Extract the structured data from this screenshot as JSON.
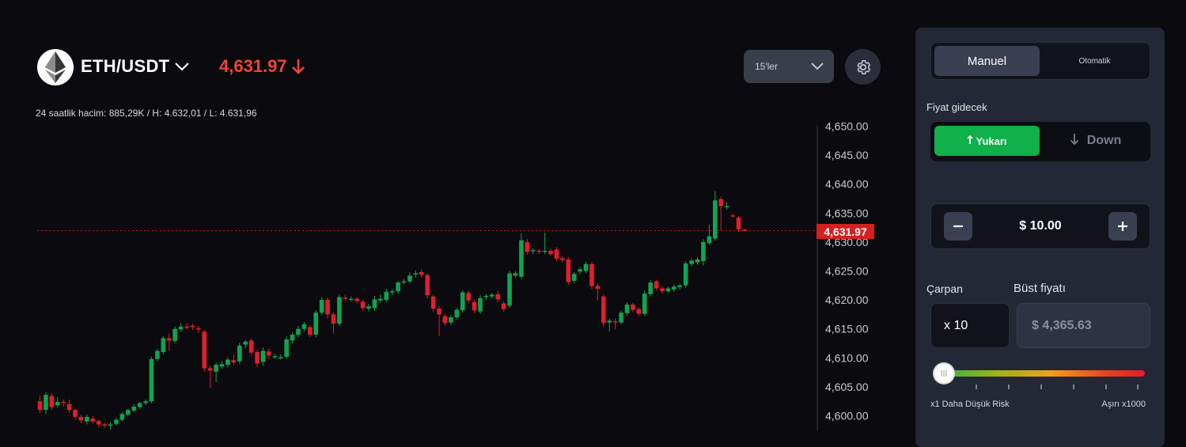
{
  "header": {
    "pair": "ETH/USDT",
    "price": "4,631.97",
    "stats": "24 saatlik hacim: 885,29K / H: 4.632,01 / L: 4.631,96",
    "interval": "15'ler"
  },
  "chart": {
    "y_ticks": [
      "4,650.00",
      "4,645.00",
      "4,640.00",
      "4,635.00",
      "4,630.00",
      "4,625.00",
      "4,620.00",
      "4,615.00",
      "4,610.00",
      "4,605.00",
      "4,600.00"
    ],
    "current_price_tag": "4,631.97",
    "colors": {
      "up": "#10a352",
      "down": "#e01e2e",
      "price_line": "#e01e2e"
    }
  },
  "panel": {
    "tabs": [
      "Manuel",
      "Otomatik"
    ],
    "direction_label": "Fiyat gidecek",
    "up_label": "Yukarı",
    "down_label": "Down",
    "amount": "$ 10.00",
    "multiplier_label": "Çarpan",
    "bust_label": "Büst fiyatı",
    "multiplier_value": "x 10",
    "bust_value": "$ 4,365.63",
    "risk_low_label": "x1 Daha Düşük Risk",
    "risk_high_label": "Aşırı x1000",
    "colors": {
      "up_button": "#10b04a",
      "panel_bg": "#242735"
    }
  },
  "chart_data": {
    "type": "candlestick",
    "y_range": [
      4600,
      4650
    ],
    "candles": [
      {
        "o": 4602.5,
        "c": 4601.0,
        "h": 4603.5,
        "l": 4600.5
      },
      {
        "o": 4601.0,
        "c": 4603.6,
        "h": 4604.1,
        "l": 4600.3
      },
      {
        "o": 4603.4,
        "c": 4601.5,
        "h": 4603.9,
        "l": 4601.0
      },
      {
        "o": 4601.8,
        "c": 4602.4,
        "h": 4603.2,
        "l": 4601.4
      },
      {
        "o": 4602.4,
        "c": 4602.2,
        "h": 4602.8,
        "l": 4601.6
      },
      {
        "o": 4602.0,
        "c": 4601.0,
        "h": 4602.8,
        "l": 4600.5
      },
      {
        "o": 4601.0,
        "c": 4599.8,
        "h": 4601.2,
        "l": 4599.4
      },
      {
        "o": 4599.8,
        "c": 4599.2,
        "h": 4600.2,
        "l": 4598.7
      },
      {
        "o": 4599.0,
        "c": 4599.8,
        "h": 4600.2,
        "l": 4598.5
      },
      {
        "o": 4599.5,
        "c": 4599.0,
        "h": 4600.0,
        "l": 4598.6
      },
      {
        "o": 4599.1,
        "c": 4598.5,
        "h": 4599.3,
        "l": 4598.0
      },
      {
        "o": 4598.5,
        "c": 4598.3,
        "h": 4598.8,
        "l": 4597.9
      },
      {
        "o": 4598.3,
        "c": 4598.5,
        "h": 4598.9,
        "l": 4597.6
      },
      {
        "o": 4598.6,
        "c": 4599.3,
        "h": 4599.7,
        "l": 4598.3
      },
      {
        "o": 4599.3,
        "c": 4600.3,
        "h": 4600.6,
        "l": 4599.0
      },
      {
        "o": 4600.2,
        "c": 4601.0,
        "h": 4601.2,
        "l": 4599.9
      },
      {
        "o": 4600.9,
        "c": 4601.6,
        "h": 4602.0,
        "l": 4600.6
      },
      {
        "o": 4601.5,
        "c": 4602.2,
        "h": 4602.4,
        "l": 4601.2
      },
      {
        "o": 4602.2,
        "c": 4602.5,
        "h": 4602.8,
        "l": 4601.8
      },
      {
        "o": 4602.5,
        "c": 4609.8,
        "h": 4610.2,
        "l": 4602.2
      },
      {
        "o": 4609.8,
        "c": 4611.2,
        "h": 4611.6,
        "l": 4609.4
      },
      {
        "o": 4611.0,
        "c": 4613.4,
        "h": 4613.7,
        "l": 4610.6
      },
      {
        "o": 4613.4,
        "c": 4613.0,
        "h": 4614.2,
        "l": 4611.2
      },
      {
        "o": 4612.9,
        "c": 4615.0,
        "h": 4615.4,
        "l": 4612.5
      },
      {
        "o": 4614.9,
        "c": 4615.4,
        "h": 4616.0,
        "l": 4614.5
      },
      {
        "o": 4615.4,
        "c": 4615.3,
        "h": 4616.0,
        "l": 4614.9
      },
      {
        "o": 4615.5,
        "c": 4615.4,
        "h": 4615.9,
        "l": 4614.8
      },
      {
        "o": 4615.1,
        "c": 4614.9,
        "h": 4615.5,
        "l": 4614.3
      },
      {
        "o": 4614.5,
        "c": 4608.2,
        "h": 4614.9,
        "l": 4607.6
      },
      {
        "o": 4608.2,
        "c": 4607.8,
        "h": 4608.6,
        "l": 4604.8
      },
      {
        "o": 4607.6,
        "c": 4608.8,
        "h": 4609.2,
        "l": 4605.8
      },
      {
        "o": 4608.5,
        "c": 4608.9,
        "h": 4609.4,
        "l": 4608.1
      },
      {
        "o": 4608.8,
        "c": 4609.7,
        "h": 4610.1,
        "l": 4608.3
      },
      {
        "o": 4609.6,
        "c": 4609.2,
        "h": 4610.6,
        "l": 4608.8
      },
      {
        "o": 4609.4,
        "c": 4612.1,
        "h": 4612.6,
        "l": 4608.9
      },
      {
        "o": 4612.3,
        "c": 4612.8,
        "h": 4613.1,
        "l": 4611.6
      },
      {
        "o": 4613.0,
        "c": 4610.9,
        "h": 4613.4,
        "l": 4610.4
      },
      {
        "o": 4611.0,
        "c": 4609.0,
        "h": 4611.4,
        "l": 4608.4
      },
      {
        "o": 4609.3,
        "c": 4611.2,
        "h": 4611.8,
        "l": 4608.6
      },
      {
        "o": 4611.1,
        "c": 4610.4,
        "h": 4611.6,
        "l": 4609.8
      },
      {
        "o": 4610.3,
        "c": 4610.3,
        "h": 4610.7,
        "l": 4609.8
      },
      {
        "o": 4610.1,
        "c": 4610.1,
        "h": 4610.6,
        "l": 4609.7
      },
      {
        "o": 4610.2,
        "c": 4613.2,
        "h": 4613.7,
        "l": 4609.8
      },
      {
        "o": 4613.0,
        "c": 4614.0,
        "h": 4614.4,
        "l": 4612.5
      },
      {
        "o": 4614.0,
        "c": 4615.0,
        "h": 4615.5,
        "l": 4613.6
      },
      {
        "o": 4615.0,
        "c": 4615.8,
        "h": 4616.2,
        "l": 4614.5
      },
      {
        "o": 4615.3,
        "c": 4614.0,
        "h": 4615.6,
        "l": 4613.6
      },
      {
        "o": 4614.0,
        "c": 4617.8,
        "h": 4618.2,
        "l": 4613.6
      },
      {
        "o": 4617.8,
        "c": 4620.0,
        "h": 4620.5,
        "l": 4617.4
      },
      {
        "o": 4620.0,
        "c": 4617.5,
        "h": 4620.4,
        "l": 4616.8
      },
      {
        "o": 4617.5,
        "c": 4615.9,
        "h": 4617.8,
        "l": 4614.2
      },
      {
        "o": 4615.9,
        "c": 4620.5,
        "h": 4620.9,
        "l": 4615.5
      },
      {
        "o": 4620.4,
        "c": 4620.2,
        "h": 4620.9,
        "l": 4619.9
      },
      {
        "o": 4620.0,
        "c": 4620.2,
        "h": 4620.6,
        "l": 4619.7
      },
      {
        "o": 4620.2,
        "c": 4619.8,
        "h": 4620.5,
        "l": 4619.4
      },
      {
        "o": 4619.7,
        "c": 4618.6,
        "h": 4620.0,
        "l": 4618.1
      },
      {
        "o": 4618.5,
        "c": 4618.9,
        "h": 4619.3,
        "l": 4618.0
      },
      {
        "o": 4618.6,
        "c": 4620.1,
        "h": 4620.7,
        "l": 4618.1
      },
      {
        "o": 4619.9,
        "c": 4620.2,
        "h": 4620.9,
        "l": 4619.5
      },
      {
        "o": 4620.0,
        "c": 4621.4,
        "h": 4621.9,
        "l": 4619.6
      },
      {
        "o": 4621.3,
        "c": 4621.5,
        "h": 4621.9,
        "l": 4620.8
      },
      {
        "o": 4621.5,
        "c": 4623.0,
        "h": 4623.3,
        "l": 4621.1
      },
      {
        "o": 4623.0,
        "c": 4623.2,
        "h": 4623.6,
        "l": 4622.7
      },
      {
        "o": 4623.2,
        "c": 4624.2,
        "h": 4624.8,
        "l": 4622.9
      },
      {
        "o": 4624.4,
        "c": 4624.6,
        "h": 4625.1,
        "l": 4623.9
      },
      {
        "o": 4624.8,
        "c": 4624.3,
        "h": 4625.3,
        "l": 4623.8
      },
      {
        "o": 4624.3,
        "c": 4620.8,
        "h": 4624.6,
        "l": 4620.3
      },
      {
        "o": 4620.6,
        "c": 4618.5,
        "h": 4620.9,
        "l": 4617.9
      },
      {
        "o": 4618.5,
        "c": 4617.5,
        "h": 4618.9,
        "l": 4613.8
      },
      {
        "o": 4617.2,
        "c": 4616.0,
        "h": 4617.6,
        "l": 4615.6
      },
      {
        "o": 4616.1,
        "c": 4617.0,
        "h": 4617.4,
        "l": 4615.7
      },
      {
        "o": 4617.0,
        "c": 4618.3,
        "h": 4618.6,
        "l": 4616.6
      },
      {
        "o": 4618.2,
        "c": 4621.3,
        "h": 4621.7,
        "l": 4617.8
      },
      {
        "o": 4621.2,
        "c": 4619.9,
        "h": 4621.6,
        "l": 4619.4
      },
      {
        "o": 4619.6,
        "c": 4618.2,
        "h": 4620.0,
        "l": 4617.7
      },
      {
        "o": 4618.0,
        "c": 4620.3,
        "h": 4620.8,
        "l": 4617.6
      },
      {
        "o": 4620.5,
        "c": 4620.7,
        "h": 4621.0,
        "l": 4620.0
      },
      {
        "o": 4620.6,
        "c": 4620.9,
        "h": 4621.2,
        "l": 4620.2
      },
      {
        "o": 4621.0,
        "c": 4620.1,
        "h": 4621.5,
        "l": 4619.6
      },
      {
        "o": 4619.4,
        "c": 4618.4,
        "h": 4619.8,
        "l": 4617.9
      },
      {
        "o": 4619.0,
        "c": 4624.6,
        "h": 4625.0,
        "l": 4618.6
      },
      {
        "o": 4624.2,
        "c": 4624.6,
        "h": 4625.0,
        "l": 4623.9
      },
      {
        "o": 4624.0,
        "c": 4630.3,
        "h": 4631.5,
        "l": 4623.6
      },
      {
        "o": 4630.0,
        "c": 4628.3,
        "h": 4630.5,
        "l": 4627.8
      },
      {
        "o": 4628.4,
        "c": 4628.6,
        "h": 4628.9,
        "l": 4627.9
      },
      {
        "o": 4628.5,
        "c": 4628.3,
        "h": 4628.8,
        "l": 4627.9
      },
      {
        "o": 4628.3,
        "c": 4628.5,
        "h": 4631.6,
        "l": 4627.9
      },
      {
        "o": 4628.5,
        "c": 4627.9,
        "h": 4628.8,
        "l": 4627.6
      },
      {
        "o": 4628.7,
        "c": 4627.1,
        "h": 4629.1,
        "l": 4626.7
      },
      {
        "o": 4627.2,
        "c": 4626.9,
        "h": 4627.5,
        "l": 4626.5
      },
      {
        "o": 4627.0,
        "c": 4623.1,
        "h": 4627.4,
        "l": 4622.6
      },
      {
        "o": 4623.3,
        "c": 4624.5,
        "h": 4624.8,
        "l": 4622.8
      },
      {
        "o": 4624.9,
        "c": 4625.3,
        "h": 4625.7,
        "l": 4624.4
      },
      {
        "o": 4625.0,
        "c": 4626.2,
        "h": 4626.6,
        "l": 4624.6
      },
      {
        "o": 4626.2,
        "c": 4622.4,
        "h": 4626.6,
        "l": 4621.9
      },
      {
        "o": 4622.4,
        "c": 4621.9,
        "h": 4622.8,
        "l": 4619.9
      },
      {
        "o": 4620.6,
        "c": 4616.0,
        "h": 4621.0,
        "l": 4615.3
      },
      {
        "o": 4616.1,
        "c": 4616.4,
        "h": 4616.8,
        "l": 4614.5
      },
      {
        "o": 4616.3,
        "c": 4616.1,
        "h": 4616.8,
        "l": 4614.9
      },
      {
        "o": 4616.1,
        "c": 4617.8,
        "h": 4618.2,
        "l": 4615.8
      },
      {
        "o": 4617.7,
        "c": 4619.2,
        "h": 4619.6,
        "l": 4617.3
      },
      {
        "o": 4619.2,
        "c": 4618.3,
        "h": 4619.5,
        "l": 4617.9
      },
      {
        "o": 4618.4,
        "c": 4617.6,
        "h": 4618.7,
        "l": 4617.2
      },
      {
        "o": 4617.6,
        "c": 4621.1,
        "h": 4621.6,
        "l": 4617.2
      },
      {
        "o": 4621.0,
        "c": 4623.0,
        "h": 4623.4,
        "l": 4620.6
      },
      {
        "o": 4623.2,
        "c": 4622.0,
        "h": 4623.5,
        "l": 4621.6
      },
      {
        "o": 4622.0,
        "c": 4621.5,
        "h": 4622.4,
        "l": 4621.1
      },
      {
        "o": 4621.5,
        "c": 4622.0,
        "h": 4622.3,
        "l": 4621.2
      },
      {
        "o": 4621.8,
        "c": 4622.3,
        "h": 4622.7,
        "l": 4621.4
      },
      {
        "o": 4622.2,
        "c": 4622.5,
        "h": 4622.8,
        "l": 4621.8
      },
      {
        "o": 4622.5,
        "c": 4626.3,
        "h": 4626.7,
        "l": 4622.1
      },
      {
        "o": 4626.2,
        "c": 4626.8,
        "h": 4627.2,
        "l": 4625.8
      },
      {
        "o": 4626.5,
        "c": 4627.0,
        "h": 4627.4,
        "l": 4626.1
      },
      {
        "o": 4626.7,
        "c": 4630.0,
        "h": 4630.5,
        "l": 4625.9
      },
      {
        "o": 4629.8,
        "c": 4631.0,
        "h": 4633.0,
        "l": 4629.5
      },
      {
        "o": 4630.6,
        "c": 4637.2,
        "h": 4638.8,
        "l": 4630.2
      },
      {
        "o": 4637.4,
        "c": 4636.2,
        "h": 4637.8,
        "l": 4632.0
      },
      {
        "o": 4636.2,
        "c": 4636.2,
        "h": 4636.9,
        "l": 4635.6
      },
      {
        "o": 4634.6,
        "c": 4634.5,
        "h": 4634.9,
        "l": 4634.2
      },
      {
        "o": 4634.2,
        "c": 4632.2,
        "h": 4634.5,
        "l": 4631.8
      },
      {
        "o": 4632.1,
        "c": 4631.97,
        "h": 4632.3,
        "l": 4631.8
      }
    ]
  }
}
